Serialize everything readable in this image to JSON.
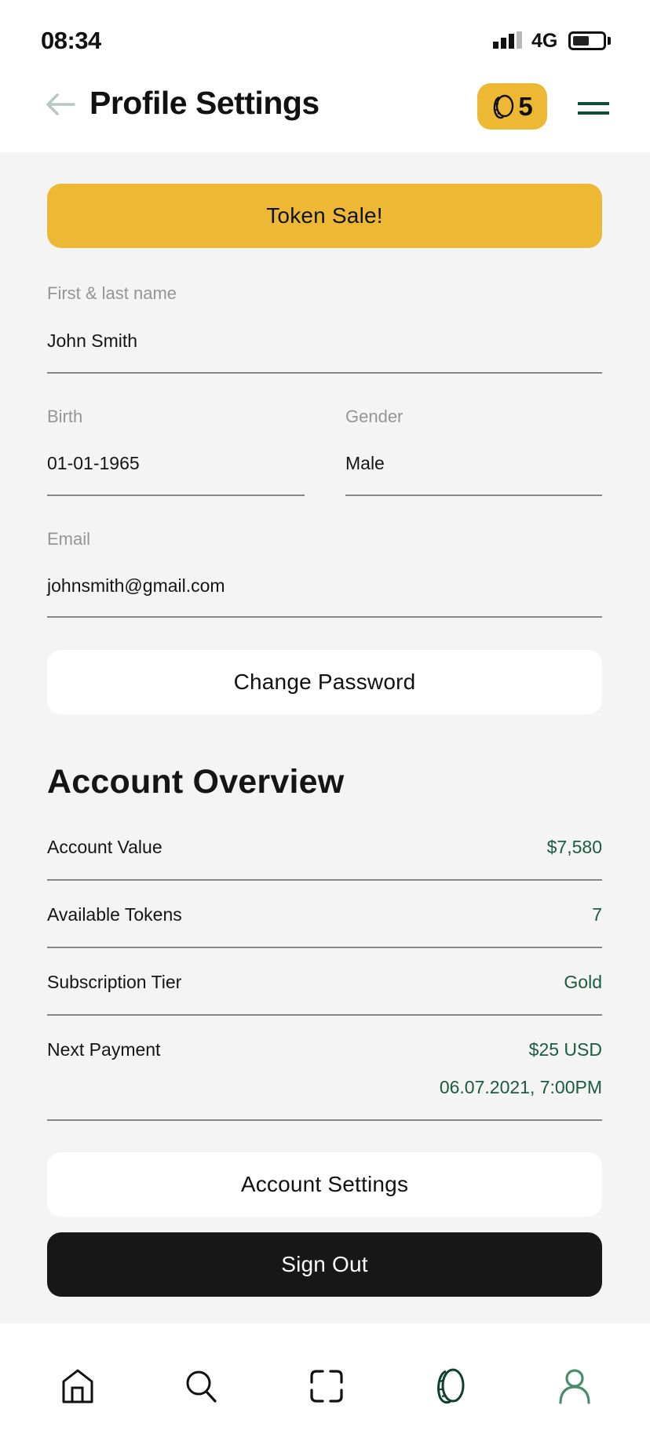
{
  "status_bar": {
    "time": "08:34",
    "network": "4G",
    "signal_bars_active": 3,
    "signal_bars_total": 4,
    "battery_level": 0.55
  },
  "header": {
    "back_icon": "arrow-left-icon",
    "title": "Profile Settings",
    "token_badge": {
      "icon": "coin-icon",
      "count": "5"
    },
    "menu_icon": "hamburger-menu-icon"
  },
  "promo": {
    "label": "Token Sale!"
  },
  "form": {
    "name": {
      "label": "First & last name",
      "value": "John Smith"
    },
    "birth": {
      "label": "Birth",
      "value": "01-01-1965"
    },
    "gender": {
      "label": "Gender",
      "value": "Male"
    },
    "email": {
      "label": "Email",
      "value": "johnsmith@gmail.com"
    }
  },
  "change_password": {
    "label": "Change Password"
  },
  "account_overview": {
    "title": "Account Overview",
    "rows": [
      {
        "label": "Account Value",
        "value": "$7,580"
      },
      {
        "label": "Available Tokens",
        "value": "7"
      },
      {
        "label": "Subscription Tier",
        "value": "Gold"
      },
      {
        "label": "Next Payment",
        "value": "$25 USD",
        "subvalue": "06.07.2021, 7:00PM"
      }
    ]
  },
  "account_settings": {
    "label": "Account Settings"
  },
  "sign_out": {
    "label": "Sign Out"
  },
  "bottom_nav": {
    "items": [
      {
        "name": "home",
        "icon": "home-icon"
      },
      {
        "name": "search",
        "icon": "search-icon"
      },
      {
        "name": "scan",
        "icon": "scan-icon"
      },
      {
        "name": "tokens",
        "icon": "coin-icon"
      },
      {
        "name": "profile",
        "icon": "user-icon",
        "active": true
      }
    ]
  },
  "colors": {
    "accent_yellow": "#EDB934",
    "brand_green": "#0d4f38",
    "value_green": "#1a5c40",
    "active_tab_green": "#4a8c6c",
    "background": "#f4f4f4"
  }
}
